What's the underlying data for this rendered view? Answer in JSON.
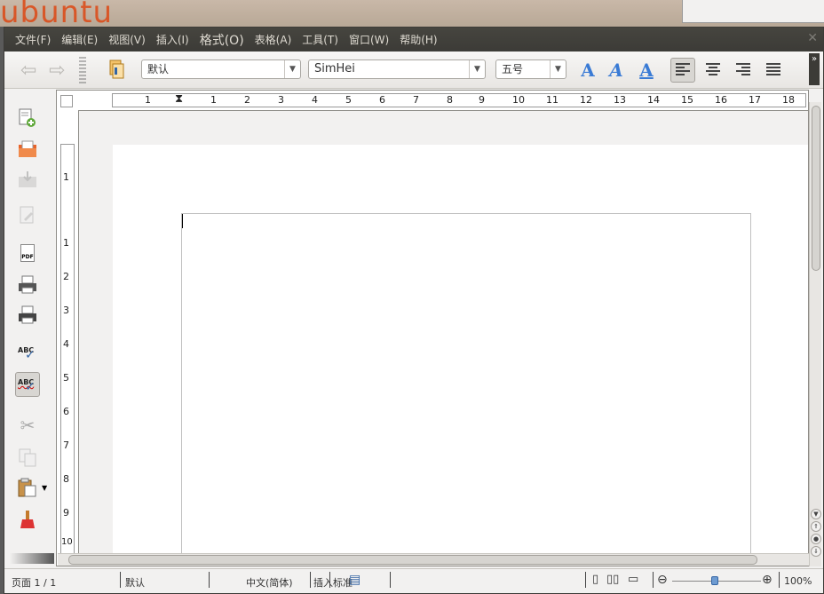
{
  "desktop": {
    "logo_text": "ubuntu"
  },
  "menubar": {
    "items": [
      {
        "label": "文件(F)"
      },
      {
        "label": "编辑(E)"
      },
      {
        "label": "视图(V)"
      },
      {
        "label": "插入(I)"
      },
      {
        "label": "格式(O)"
      },
      {
        "label": "表格(A)"
      },
      {
        "label": "工具(T)"
      },
      {
        "label": "窗口(W)"
      },
      {
        "label": "帮助(H)"
      }
    ],
    "close_icon": "close-icon"
  },
  "toolbar": {
    "paragraph_style": "默认",
    "font_name": "SimHei",
    "font_size": "五号",
    "bold_glyph": "A",
    "italic_glyph": "A",
    "underline_glyph": "A",
    "more_glyph": "»"
  },
  "rulers": {
    "horizontal_ticks": [
      "1",
      "1",
      "2",
      "3",
      "4",
      "5",
      "6",
      "7",
      "8",
      "9",
      "10",
      "11",
      "12",
      "13",
      "14",
      "15",
      "16",
      "17",
      "18"
    ],
    "vertical_ticks": [
      "1",
      "1",
      "2",
      "3",
      "4",
      "5",
      "6",
      "7",
      "8",
      "9",
      "10"
    ]
  },
  "sidebar": {
    "icons": [
      "new-document-icon",
      "open-icon",
      "save-icon",
      "edit-file-icon",
      "export-pdf-icon",
      "print-direct-icon",
      "print-preview-icon",
      "spellcheck-icon",
      "autospellcheck-icon",
      "cut-icon",
      "copy-icon",
      "paste-icon",
      "clone-formatting-icon"
    ],
    "pdf_label": "PDF",
    "abc_label": "ABC"
  },
  "statusbar": {
    "page": "页面 1 / 1",
    "style": "默认",
    "language": "中文(简体)",
    "insert_mode": "插入",
    "selection_mode": "标准",
    "zoom": "100%",
    "zoom_minus": "⊖",
    "zoom_plus": "⊕"
  }
}
